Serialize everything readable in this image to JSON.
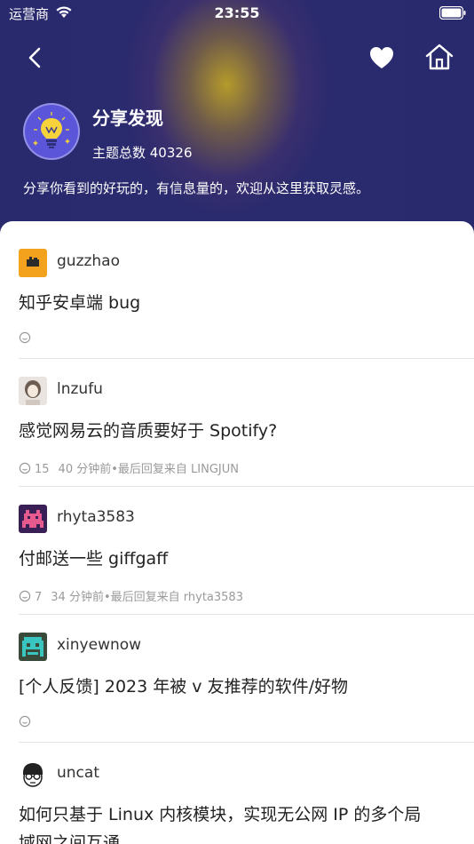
{
  "status_bar": {
    "carrier": "运营商",
    "time": "23:55"
  },
  "node": {
    "title": "分享发现",
    "topic_count": "主题总数 40326",
    "description": "分享你看到的好玩的，有信息量的，欢迎从这里获取灵感。"
  },
  "colors": {
    "header_bg": "#2a2a6e",
    "avatar_bg": "#5b56d9",
    "meta_text": "#9a9a9a"
  },
  "topics": [
    {
      "username": "guzzhao",
      "title": "知乎安卓端 bug",
      "replies": "",
      "time": "",
      "last_reply": ""
    },
    {
      "username": "lnzufu",
      "title": "感觉网易云的音质要好于 Spotify?",
      "replies": "15",
      "time": "40 分钟前",
      "last_reply": "•最后回复来自 LINGJUN"
    },
    {
      "username": "rhyta3583",
      "title": "付邮送一些 giffgaff",
      "replies": "7",
      "time": "34 分钟前",
      "last_reply": "•最后回复来自 rhyta3583"
    },
    {
      "username": "xinyewnow",
      "title": "[个人反馈] 2023 年被 v 友推荐的软件/好物",
      "replies": "",
      "time": "",
      "last_reply": ""
    },
    {
      "username": "uncat",
      "title": "如何只基于 Linux 内核模块，实现无公网 IP 的多个局",
      "title_line2": "域网之间互通",
      "replies": "",
      "time": "",
      "last_reply": ""
    }
  ]
}
